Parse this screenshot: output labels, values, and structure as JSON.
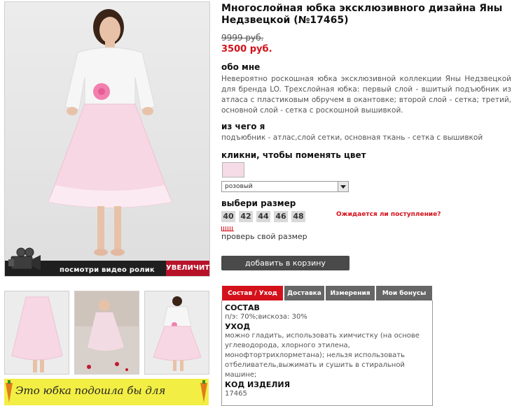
{
  "product": {
    "title": "Многослойная юбка эксклюзивного дизайна Яны Недзвецкой (№17465)",
    "old_price": "9999 руб.",
    "new_price": "3500 руб."
  },
  "about": {
    "heading": "обо мне",
    "text": "Невероятно роскошная юбка эксклюзивной коллекции Яны Недзвецкой для бренда LO. Трехслойная юбка: первый слой - вшитый подъюбник из атласа с пластиковым обручем в окантовке; второй слой - сетка; третий, основной слой - сетка с роскошной вышивкой."
  },
  "material": {
    "heading": "из чего я",
    "text": "подъюбник - атлас,слой сетки, основная ткань - сетка с вышивкой"
  },
  "color": {
    "heading": "кликни, чтобы поменять цвет",
    "selected": "розовый",
    "swatch_color": "#f5dbe6"
  },
  "size": {
    "heading": "выбери размер",
    "options": [
      "40",
      "42",
      "44",
      "46",
      "48"
    ],
    "await_link": "Ожидается ли поступление?",
    "check_link": "проверь свой размер"
  },
  "cart_button": "добавить в корзину",
  "photo": {
    "video_label": "посмотри видео ролик",
    "zoom_label": "УВЕЛИЧИТЬ"
  },
  "banner": {
    "text": "Это юбка подошла бы для"
  },
  "tabs": [
    "Состав / Уход",
    "Доставка",
    "Измерения",
    "Мои бонусы"
  ],
  "care": {
    "composition_heading": "СОСТАВ",
    "composition_text": "п/э: 70%;вискоза: 30%",
    "care_heading": "УХОД",
    "care_text": "можно гладить, использовать химчистку (на основе углеводорода, хлорного этилена, монофтортрихлорметана); нельзя использовать отбеливатель,выжимать и сушить в стиральной машине;",
    "code_heading": "КОД ИЗДЕЛИЯ",
    "code_value": "17465"
  },
  "colors": {
    "accent_red": "#d4111b",
    "button_dark": "#4a4a4a",
    "tab_gray": "#666666",
    "banner_yellow": "#f2ee44"
  }
}
